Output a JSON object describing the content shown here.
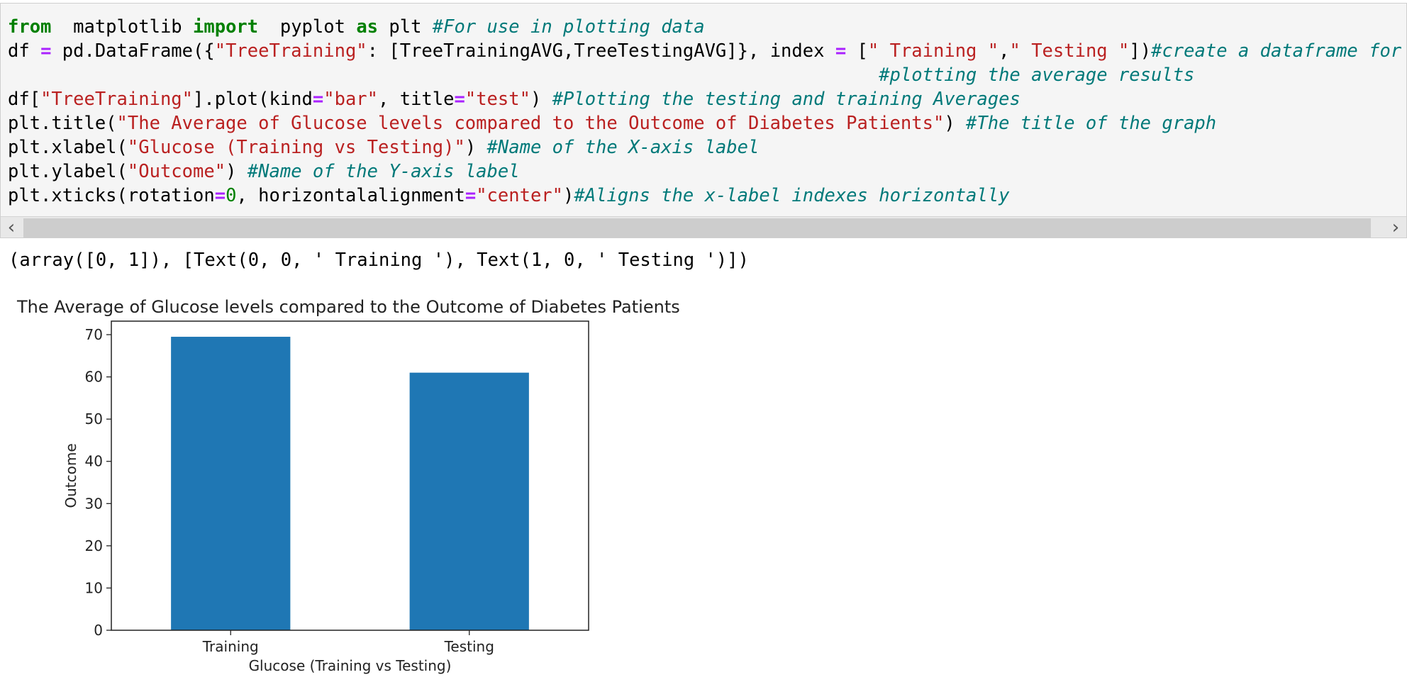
{
  "code_cell": {
    "lines": [
      [
        [
          "kw",
          "from"
        ],
        [
          "",
          "  matplotlib "
        ],
        [
          "kw",
          "import"
        ],
        [
          "",
          "  pyplot "
        ],
        [
          "kw",
          "as"
        ],
        [
          "",
          " plt "
        ],
        [
          "cm",
          "#For use in plotting data"
        ]
      ],
      [
        [
          "",
          "df "
        ],
        [
          "op",
          "="
        ],
        [
          "",
          " pd.DataFrame({"
        ],
        [
          "str",
          "\"TreeTraining\""
        ],
        [
          "",
          ": [TreeTrainingAVG,TreeTestingAVG]}, index "
        ],
        [
          "op",
          "="
        ],
        [
          "",
          " ["
        ],
        [
          "str",
          "\" Training \""
        ],
        [
          "",
          ","
        ],
        [
          "str",
          "\" Testing \""
        ],
        [
          "",
          "])"
        ],
        [
          "cm",
          "#create a dataframe for"
        ]
      ],
      [
        [
          "",
          "                                                                                "
        ],
        [
          "cm",
          "#plotting the average results"
        ]
      ],
      [
        [
          "",
          "df["
        ],
        [
          "str",
          "\"TreeTraining\""
        ],
        [
          "",
          "].plot(kind"
        ],
        [
          "op",
          "="
        ],
        [
          "str",
          "\"bar\""
        ],
        [
          "",
          ", title"
        ],
        [
          "op",
          "="
        ],
        [
          "str",
          "\"test\""
        ],
        [
          "",
          ") "
        ],
        [
          "cm",
          "#Plotting the testing and training Averages"
        ]
      ],
      [
        [
          "",
          "plt.title("
        ],
        [
          "str",
          "\"The Average of Glucose levels compared to the Outcome of Diabetes Patients\""
        ],
        [
          "",
          ") "
        ],
        [
          "cm",
          "#The title of the graph"
        ]
      ],
      [
        [
          "",
          "plt.xlabel("
        ],
        [
          "str",
          "\"Glucose (Training vs Testing)\""
        ],
        [
          "",
          ") "
        ],
        [
          "cm",
          "#Name of the X-axis label"
        ]
      ],
      [
        [
          "",
          "plt.ylabel("
        ],
        [
          "str",
          "\"Outcome\""
        ],
        [
          "",
          ") "
        ],
        [
          "cm",
          "#Name of the Y-axis label"
        ]
      ],
      [
        [
          "",
          "plt.xticks(rotation"
        ],
        [
          "op",
          "="
        ],
        [
          "num",
          "0"
        ],
        [
          "",
          ", horizontalalignment"
        ],
        [
          "op",
          "="
        ],
        [
          "str",
          "\"center\""
        ],
        [
          "",
          ")"
        ],
        [
          "cm",
          "#Aligns the x-label indexes horizontally"
        ]
      ]
    ],
    "scroll_left_icon": "chevron-left-icon",
    "scroll_right_icon": "chevron-right-icon",
    "scroll_left_glyph": "‹",
    "scroll_right_glyph": "›"
  },
  "output_text": "(array([0, 1]), [Text(0, 0, ' Training '), Text(1, 0, ' Testing ')])",
  "chart_data": {
    "type": "bar",
    "title": "The Average of Glucose levels compared to the Outcome of Diabetes Patients",
    "xlabel": "Glucose (Training vs Testing)",
    "ylabel": "Outcome",
    "categories": [
      "Training",
      "Testing"
    ],
    "values": [
      69.5,
      61.0
    ],
    "ylim": [
      0,
      73.2
    ],
    "yticks": [
      0,
      10,
      20,
      30,
      40,
      50,
      60,
      70
    ],
    "bar_color": "#1f77b4",
    "grid": false,
    "legend": false
  }
}
